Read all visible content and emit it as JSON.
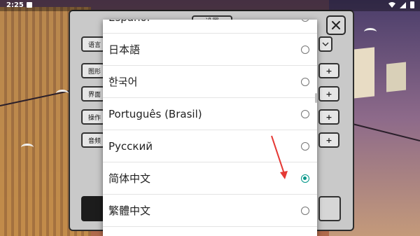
{
  "status_bar": {
    "time": "2:25"
  },
  "panel": {
    "tab_label": "设置",
    "rows": [
      {
        "label": "语言"
      },
      {
        "label": "图形",
        "control": "+"
      },
      {
        "label": "界面",
        "control": "+"
      },
      {
        "label": "操作",
        "control": "+"
      },
      {
        "label": "音频",
        "control": "+"
      }
    ]
  },
  "language_dialog": {
    "selected": "简体中文",
    "options": [
      {
        "label": "Español",
        "selected": false
      },
      {
        "label": "日本語",
        "selected": false
      },
      {
        "label": "한국어",
        "selected": false
      },
      {
        "label": "Português (Brasil)",
        "selected": false
      },
      {
        "label": "Русский",
        "selected": false
      },
      {
        "label": "简体中文",
        "selected": true
      },
      {
        "label": "繁體中文",
        "selected": false
      }
    ]
  },
  "colors": {
    "accent": "#009688",
    "annotation_arrow": "#e53935"
  }
}
